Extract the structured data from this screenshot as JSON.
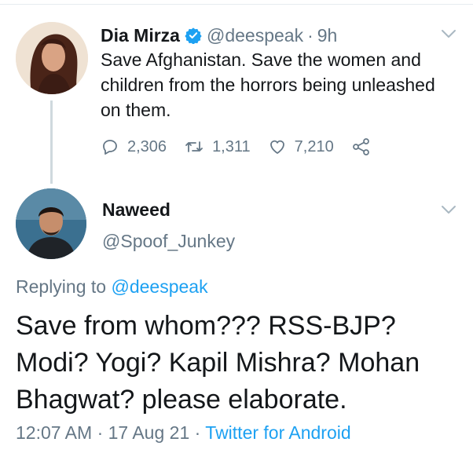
{
  "parent_tweet": {
    "author_name": "Dia Mirza",
    "handle": "@deespeak",
    "separator": "·",
    "time": "9h",
    "text": "Save Afghanistan. Save the women and children from the horrors being unleashed on them.",
    "replies_count": "2,306",
    "retweets_count": "1,311",
    "likes_count": "7,210",
    "icons": [
      "verified-badge-icon",
      "reply-icon",
      "retweet-icon",
      "like-icon",
      "share-icon",
      "chevron-down-icon"
    ],
    "accent_color": "#1da1f2"
  },
  "reply_tweet": {
    "author_name": "Naweed",
    "handle": "@Spoof_Junkey",
    "replying_prefix": "Replying to",
    "replying_to": "@deespeak",
    "text": "Save from whom??? RSS-BJP? Modi? Yogi? Kapil Mishra? Mohan Bhagwat? please elaborate.",
    "timestamp": "12:07 AM",
    "date": "17 Aug 21",
    "separator": "·",
    "source": "Twitter for Android"
  }
}
